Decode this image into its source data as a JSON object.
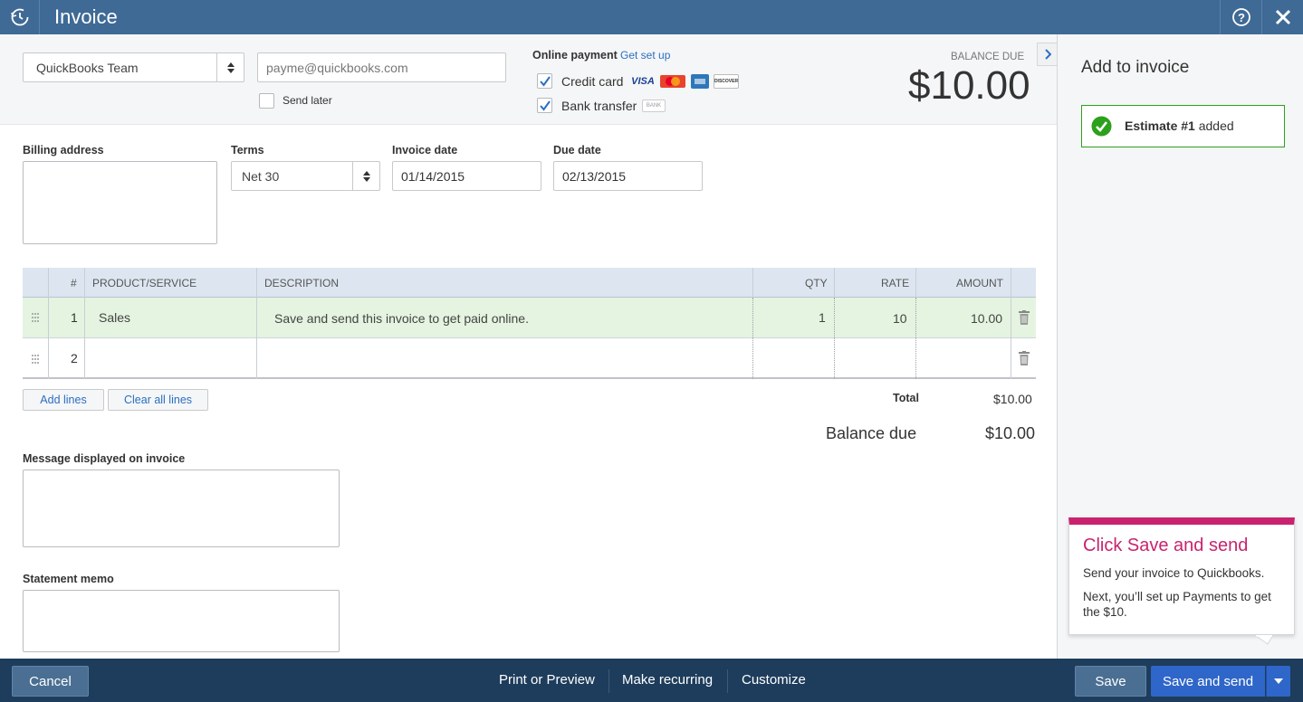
{
  "header": {
    "title": "Invoice"
  },
  "customer": {
    "value": "QuickBooks Team"
  },
  "email": {
    "placeholder": "payme@quickbooks.com"
  },
  "send_later": {
    "label": "Send later"
  },
  "online_payment": {
    "label": "Online payment",
    "setup_link": "Get set up",
    "credit_card": {
      "label": "Credit card",
      "checked": true,
      "cards": [
        "VISA",
        "MasterCard",
        "AMEX",
        "DISCOVER"
      ]
    },
    "bank_transfer": {
      "label": "Bank transfer",
      "checked": true,
      "badge": "BANK"
    }
  },
  "balance": {
    "label": "BALANCE DUE",
    "amount": "$10.00"
  },
  "billing": {
    "label": "Billing address"
  },
  "terms": {
    "label": "Terms",
    "value": "Net 30"
  },
  "invoice_date": {
    "label": "Invoice date",
    "value": "01/14/2015"
  },
  "due_date": {
    "label": "Due date",
    "value": "02/13/2015"
  },
  "table": {
    "headers": [
      "#",
      "PRODUCT/SERVICE",
      "DESCRIPTION",
      "QTY",
      "RATE",
      "AMOUNT"
    ],
    "rows": [
      {
        "num": "1",
        "product": "Sales",
        "description": "Save and send this invoice to get paid online.",
        "qty": "1",
        "rate": "10",
        "amount": "10.00"
      },
      {
        "num": "2",
        "product": "",
        "description": "",
        "qty": "",
        "rate": "",
        "amount": ""
      }
    ]
  },
  "actions": {
    "add_lines": "Add lines",
    "clear_lines": "Clear all lines"
  },
  "totals": {
    "total_label": "Total",
    "total_value": "$10.00",
    "balance_label": "Balance due",
    "balance_value": "$10.00"
  },
  "message": {
    "label": "Message displayed on invoice"
  },
  "memo": {
    "label": "Statement memo"
  },
  "sidebar": {
    "title": "Add to invoice",
    "notice_bold": "Estimate #1",
    "notice_rest": " added",
    "tip_title": "Click Save and send",
    "tip_line1": "Send your invoice to Quickbooks.",
    "tip_line2": "Next, you’ll set up Payments to get the $10."
  },
  "footer": {
    "cancel": "Cancel",
    "print": "Print or Preview",
    "recurring": "Make recurring",
    "customize": "Customize",
    "save": "Save",
    "save_send": "Save and send"
  },
  "colors": {
    "header": "#3f6a95",
    "footer": "#1e3d5c",
    "accent_green": "#2ca01c",
    "tip_pink": "#c9236f",
    "primary": "#2f66c9"
  },
  "icons": [
    "history-icon",
    "help-icon",
    "close-icon",
    "sort-arrows-icon",
    "check-icon",
    "drag-handle-icon",
    "trash-icon",
    "chevron-right-icon",
    "chevron-down-icon",
    "check-circle-icon"
  ]
}
